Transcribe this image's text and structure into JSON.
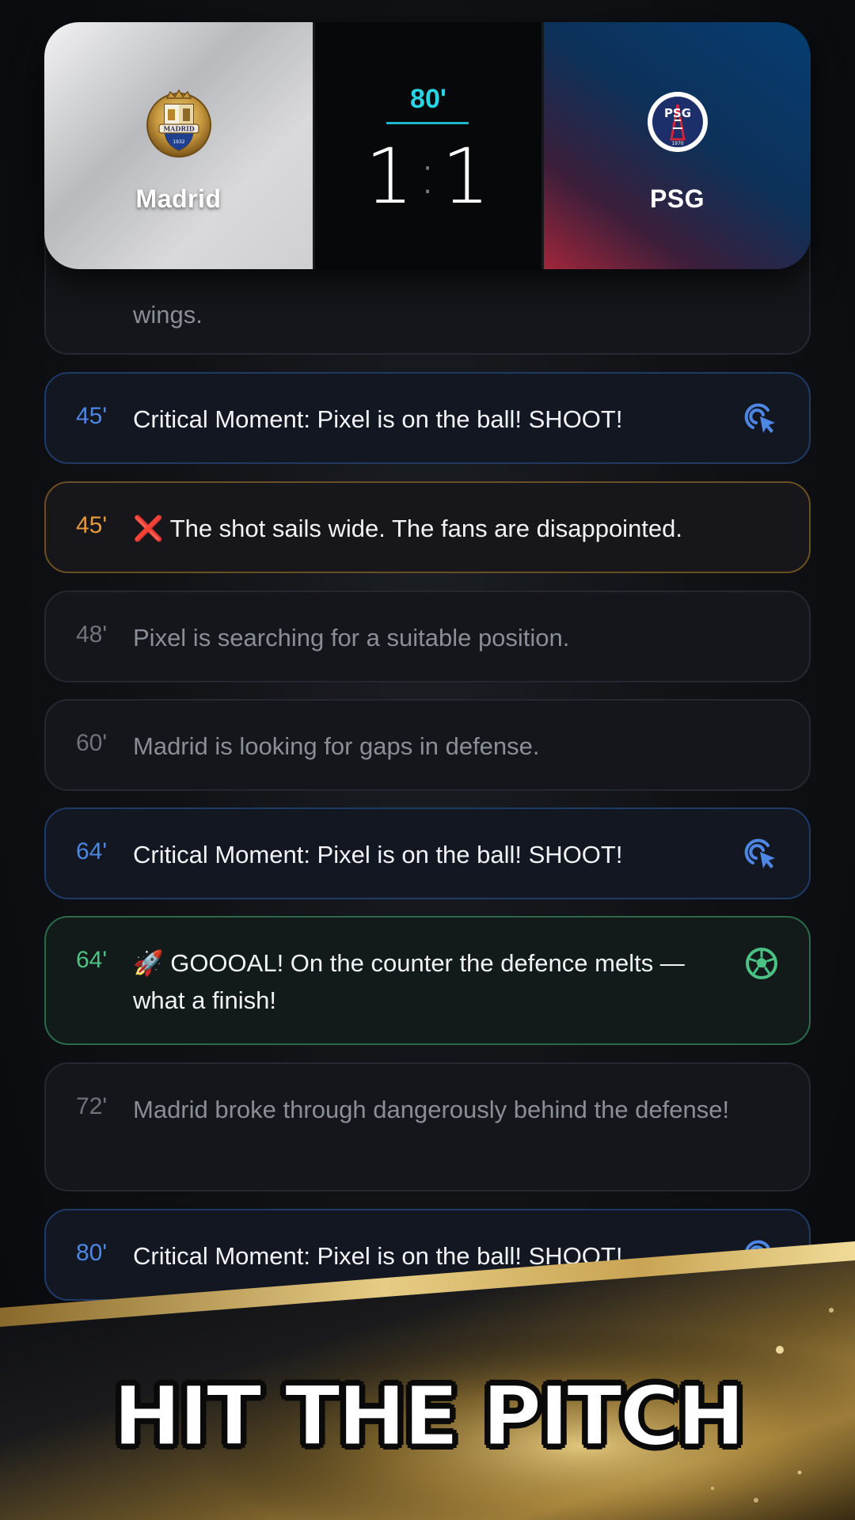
{
  "scoreboard": {
    "home_team": "Madrid",
    "away_team": "PSG",
    "minute": "80'",
    "home_score": "1",
    "away_score": "1",
    "separator": ":",
    "home_crest_text": "MADRID",
    "home_crest_year": "1932",
    "away_crest_text": "PSG",
    "away_crest_year": "1970"
  },
  "feed": {
    "partial_text": "wings.",
    "events": [
      {
        "minute": "45'",
        "text": "Critical Moment: Pixel is on the ball! SHOOT!",
        "kind": "critical",
        "icon": "tap-icon"
      },
      {
        "minute": "45'",
        "text": "❌ The shot sails wide. The fans are disappointed.",
        "kind": "miss"
      },
      {
        "minute": "48'",
        "text": "Pixel is searching for a suitable position.",
        "kind": "neutral"
      },
      {
        "minute": "60'",
        "text": "Madrid is looking for gaps in defense.",
        "kind": "neutral"
      },
      {
        "minute": "64'",
        "text": "Critical Moment: Pixel is on the ball! SHOOT!",
        "kind": "critical",
        "icon": "tap-icon"
      },
      {
        "minute": "64'",
        "text": "🚀 GOOOAL! On the counter the defence melts — what a finish!",
        "kind": "goal",
        "icon": "soccer-ball-icon"
      },
      {
        "minute": "72'",
        "text": "Madrid broke through dangerously behind the defense!",
        "kind": "neutral"
      },
      {
        "minute": "80'",
        "text": "Critical Moment: Pixel is on the ball! SHOOT!",
        "kind": "critical",
        "icon": "tap-icon"
      }
    ]
  },
  "banner": {
    "title": "HIT THE PITCH"
  },
  "colors": {
    "critical": "#4e86e4",
    "miss": "#e49a3b",
    "goal": "#4cc184",
    "minute_accent": "#29d3e3",
    "gold": "#d8b560"
  }
}
